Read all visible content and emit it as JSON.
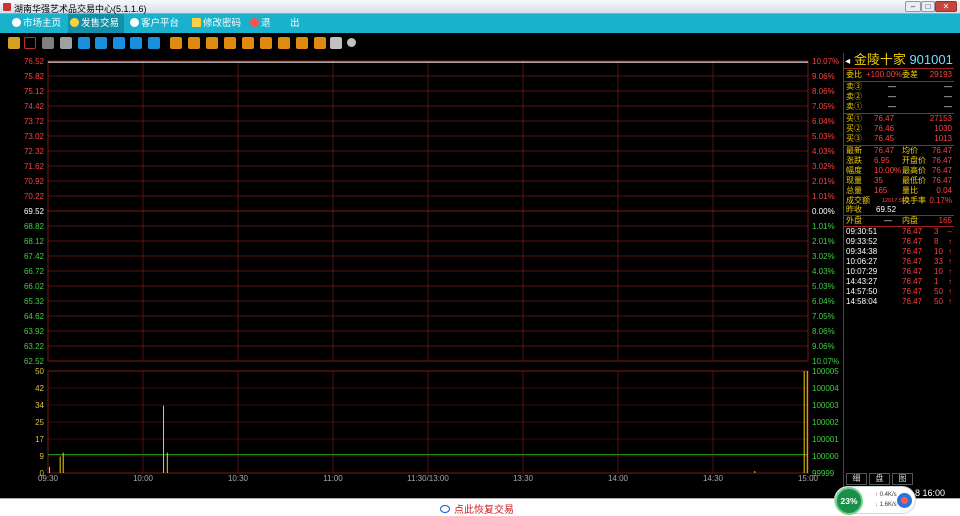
{
  "window": {
    "title": "湖南华强艺术品交易中心(5.1.1.6)",
    "min_label": "–",
    "max_label": "□",
    "close_label": "✕"
  },
  "menu": {
    "items": [
      {
        "label": "市场主页",
        "icon": "globe-icon"
      },
      {
        "label": "发售交易",
        "icon": "yen-icon",
        "active": true
      },
      {
        "label": "客户平台",
        "icon": "globe-icon"
      },
      {
        "label": "修改密码",
        "icon": "key-icon"
      },
      {
        "label": "退",
        "icon": "power-icon"
      },
      {
        "label": "出",
        "icon": ""
      }
    ]
  },
  "toolbar": {
    "buttons": [
      {
        "name": "kline-button",
        "color": "#d8a020"
      },
      {
        "name": "timeshare-button",
        "color": "#c03030"
      },
      {
        "name": "candle-button",
        "color": "#808080"
      },
      {
        "name": "calendar-button",
        "color": "#a0a0a0"
      },
      {
        "name": "tool-button-1",
        "color": "#1a8fe0"
      },
      {
        "name": "tool-button-2",
        "color": "#1a8fe0"
      },
      {
        "name": "tool-button-3",
        "color": "#1a8fe0"
      },
      {
        "name": "tool-button-4",
        "color": "#1a8fe0"
      },
      {
        "name": "tool-button-5",
        "color": "#1a8fe0"
      },
      {
        "name": "tool-button-6",
        "color": "#e08a10"
      },
      {
        "name": "tool-button-7",
        "color": "#e08a10"
      },
      {
        "name": "tool-button-8",
        "color": "#e08a10"
      },
      {
        "name": "tool-button-9",
        "color": "#e08a10"
      },
      {
        "name": "tool-button-10",
        "color": "#e08a10"
      },
      {
        "name": "tool-button-11",
        "color": "#e08a10"
      },
      {
        "name": "tool-button-12",
        "color": "#e08a10"
      },
      {
        "name": "tool-button-13",
        "color": "#e08a10"
      },
      {
        "name": "tool-button-14",
        "color": "#e08a10"
      },
      {
        "name": "draw-button",
        "color": "#c0c0c0"
      },
      {
        "name": "settings-button",
        "color": "#c0c0c0"
      }
    ]
  },
  "chart_data": {
    "type": "line",
    "price_axis": {
      "left_ticks": [
        "76.52",
        "75.82",
        "75.12",
        "74.42",
        "73.72",
        "73.02",
        "72.32",
        "71.62",
        "70.92",
        "70.22",
        "69.52",
        "68.82",
        "68.12",
        "67.42",
        "66.72",
        "66.02",
        "65.32",
        "64.62",
        "63.92",
        "63.22",
        "62.52"
      ],
      "right_ticks": [
        "10.07%",
        "9.06%",
        "8.06%",
        "7.05%",
        "6.04%",
        "5.03%",
        "4.03%",
        "3.02%",
        "2.01%",
        "1.01%",
        "0.00%",
        "1.01%",
        "2.01%",
        "3.02%",
        "4.03%",
        "5.03%",
        "6.04%",
        "7.05%",
        "8.06%",
        "9.06%",
        "10.07%"
      ],
      "prev_close": 69.52,
      "ylim": [
        62.52,
        76.52
      ]
    },
    "volume_axis": {
      "left_ticks": [
        "50",
        "42",
        "34",
        "25",
        "17",
        "9",
        "0"
      ],
      "right_ticks": [
        "100005",
        "100004",
        "100003",
        "100002",
        "100001",
        "100000",
        "99999"
      ],
      "ylim": [
        0,
        50
      ]
    },
    "time_ticks": [
      "09:30",
      "10:00",
      "10:30",
      "11:00",
      "11:30/13:00",
      "13:30",
      "14:00",
      "14:30",
      "15:00"
    ],
    "price_series": [
      {
        "x": "09:30",
        "y": 76.47
      },
      {
        "x": "15:00",
        "y": 76.47
      }
    ],
    "volume_bars": [
      {
        "t": 0.002,
        "v": 3
      },
      {
        "t": 0.016,
        "v": 8
      },
      {
        "t": 0.02,
        "v": 10
      },
      {
        "t": 0.152,
        "v": 33
      },
      {
        "t": 0.157,
        "v": 10
      },
      {
        "t": 0.93,
        "v": 1
      },
      {
        "t": 0.995,
        "v": 50
      },
      {
        "t": 0.999,
        "v": 50
      }
    ],
    "baseline_volume": 9
  },
  "quote": {
    "name": "金陵十家",
    "code": "901001",
    "ratio": {
      "label": "委比",
      "value": "+100.00%"
    },
    "diff": {
      "label": "委差",
      "value": "29193"
    },
    "sells": [
      {
        "label": "卖③",
        "price": "—",
        "vol": "—"
      },
      {
        "label": "卖②",
        "price": "—",
        "vol": "—"
      },
      {
        "label": "卖①",
        "price": "—",
        "vol": "—"
      }
    ],
    "buys": [
      {
        "label": "买①",
        "price": "76.47",
        "vol": "27153"
      },
      {
        "label": "买②",
        "price": "76.46",
        "vol": "1030"
      },
      {
        "label": "买③",
        "price": "76.45",
        "vol": "1013"
      }
    ],
    "stats": [
      [
        "最新",
        "76.47",
        "均价",
        "76.47"
      ],
      [
        "涨跌",
        "6.95",
        "开盘价",
        "76.47"
      ],
      [
        "幅度",
        "10.00%",
        "最高价",
        "76.47"
      ],
      [
        "现量",
        "35",
        "最低价",
        "76.47"
      ],
      [
        "总量",
        "165",
        "量比",
        "0.04"
      ],
      [
        "成交额",
        "12617.55",
        "换手率",
        "0.17%"
      ]
    ],
    "prev": {
      "label": "昨收",
      "value": "69.52"
    },
    "outer": {
      "label": "外盘",
      "value": "—"
    },
    "inner": {
      "label": "内盘",
      "value": "165"
    },
    "ticks": [
      [
        "09:30:51",
        "76.47",
        "3",
        "–"
      ],
      [
        "09:33:52",
        "76.47",
        "8",
        "↑"
      ],
      [
        "09:34:38",
        "76.47",
        "10",
        "↑"
      ],
      [
        "10:06:27",
        "76.47",
        "33",
        "↑"
      ],
      [
        "10:07:29",
        "76.47",
        "10",
        "↑"
      ],
      [
        "14:43:27",
        "76.47",
        "1",
        "↑"
      ],
      [
        "14:57:50",
        "76.47",
        "50",
        "↑"
      ],
      [
        "14:58:04",
        "76.47",
        "50",
        "↑"
      ]
    ],
    "tabs": [
      "细",
      "盘",
      "图"
    ]
  },
  "status": {
    "resume_label": "点此恢复交易",
    "time": "8 16:00"
  },
  "widget": {
    "percent": "23%",
    "up_speed": "0.4K/s",
    "down_speed": "1.6K/s"
  },
  "colors": {
    "grid": "#7a1818",
    "price_line": "#ffffff",
    "up": "#ff4040",
    "down": "#40d040",
    "volume_bar": "#f0d000",
    "menu_bg": "#19b1cc"
  }
}
